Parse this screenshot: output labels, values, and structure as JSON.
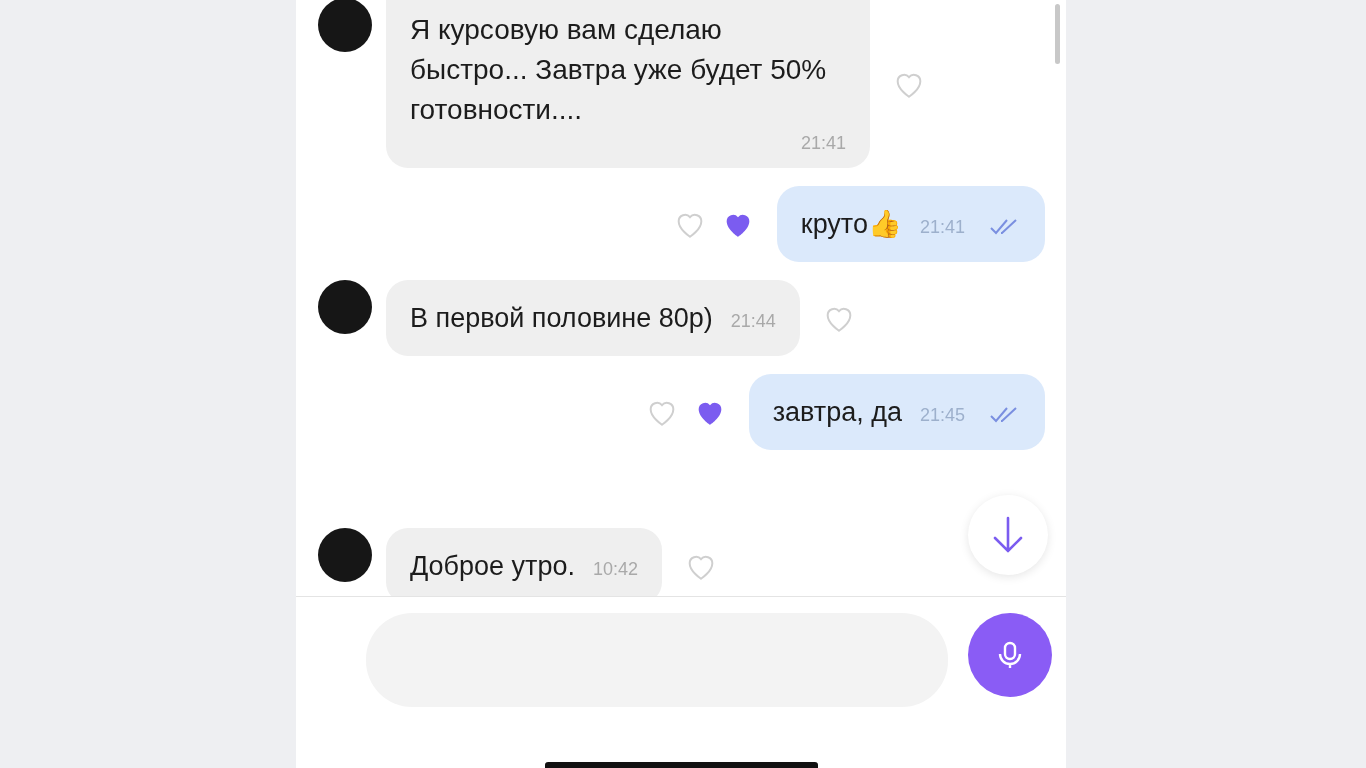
{
  "messages": [
    {
      "kind": "incoming",
      "text": "Я курсовую вам сделаю быстро... Завтра уже будет 50% готовности....",
      "time": "21:41",
      "liked": false
    },
    {
      "kind": "outgoing",
      "text": "круто👍",
      "time": "21:41",
      "liked": true
    },
    {
      "kind": "incoming",
      "text": "В первой половине 80р)",
      "time": "21:44",
      "liked": false
    },
    {
      "kind": "outgoing",
      "text": "завтра, да",
      "time": "21:45",
      "liked": true
    },
    {
      "kind": "incoming",
      "text": "Доброе утро.",
      "time": "10:42",
      "liked": false
    }
  ]
}
